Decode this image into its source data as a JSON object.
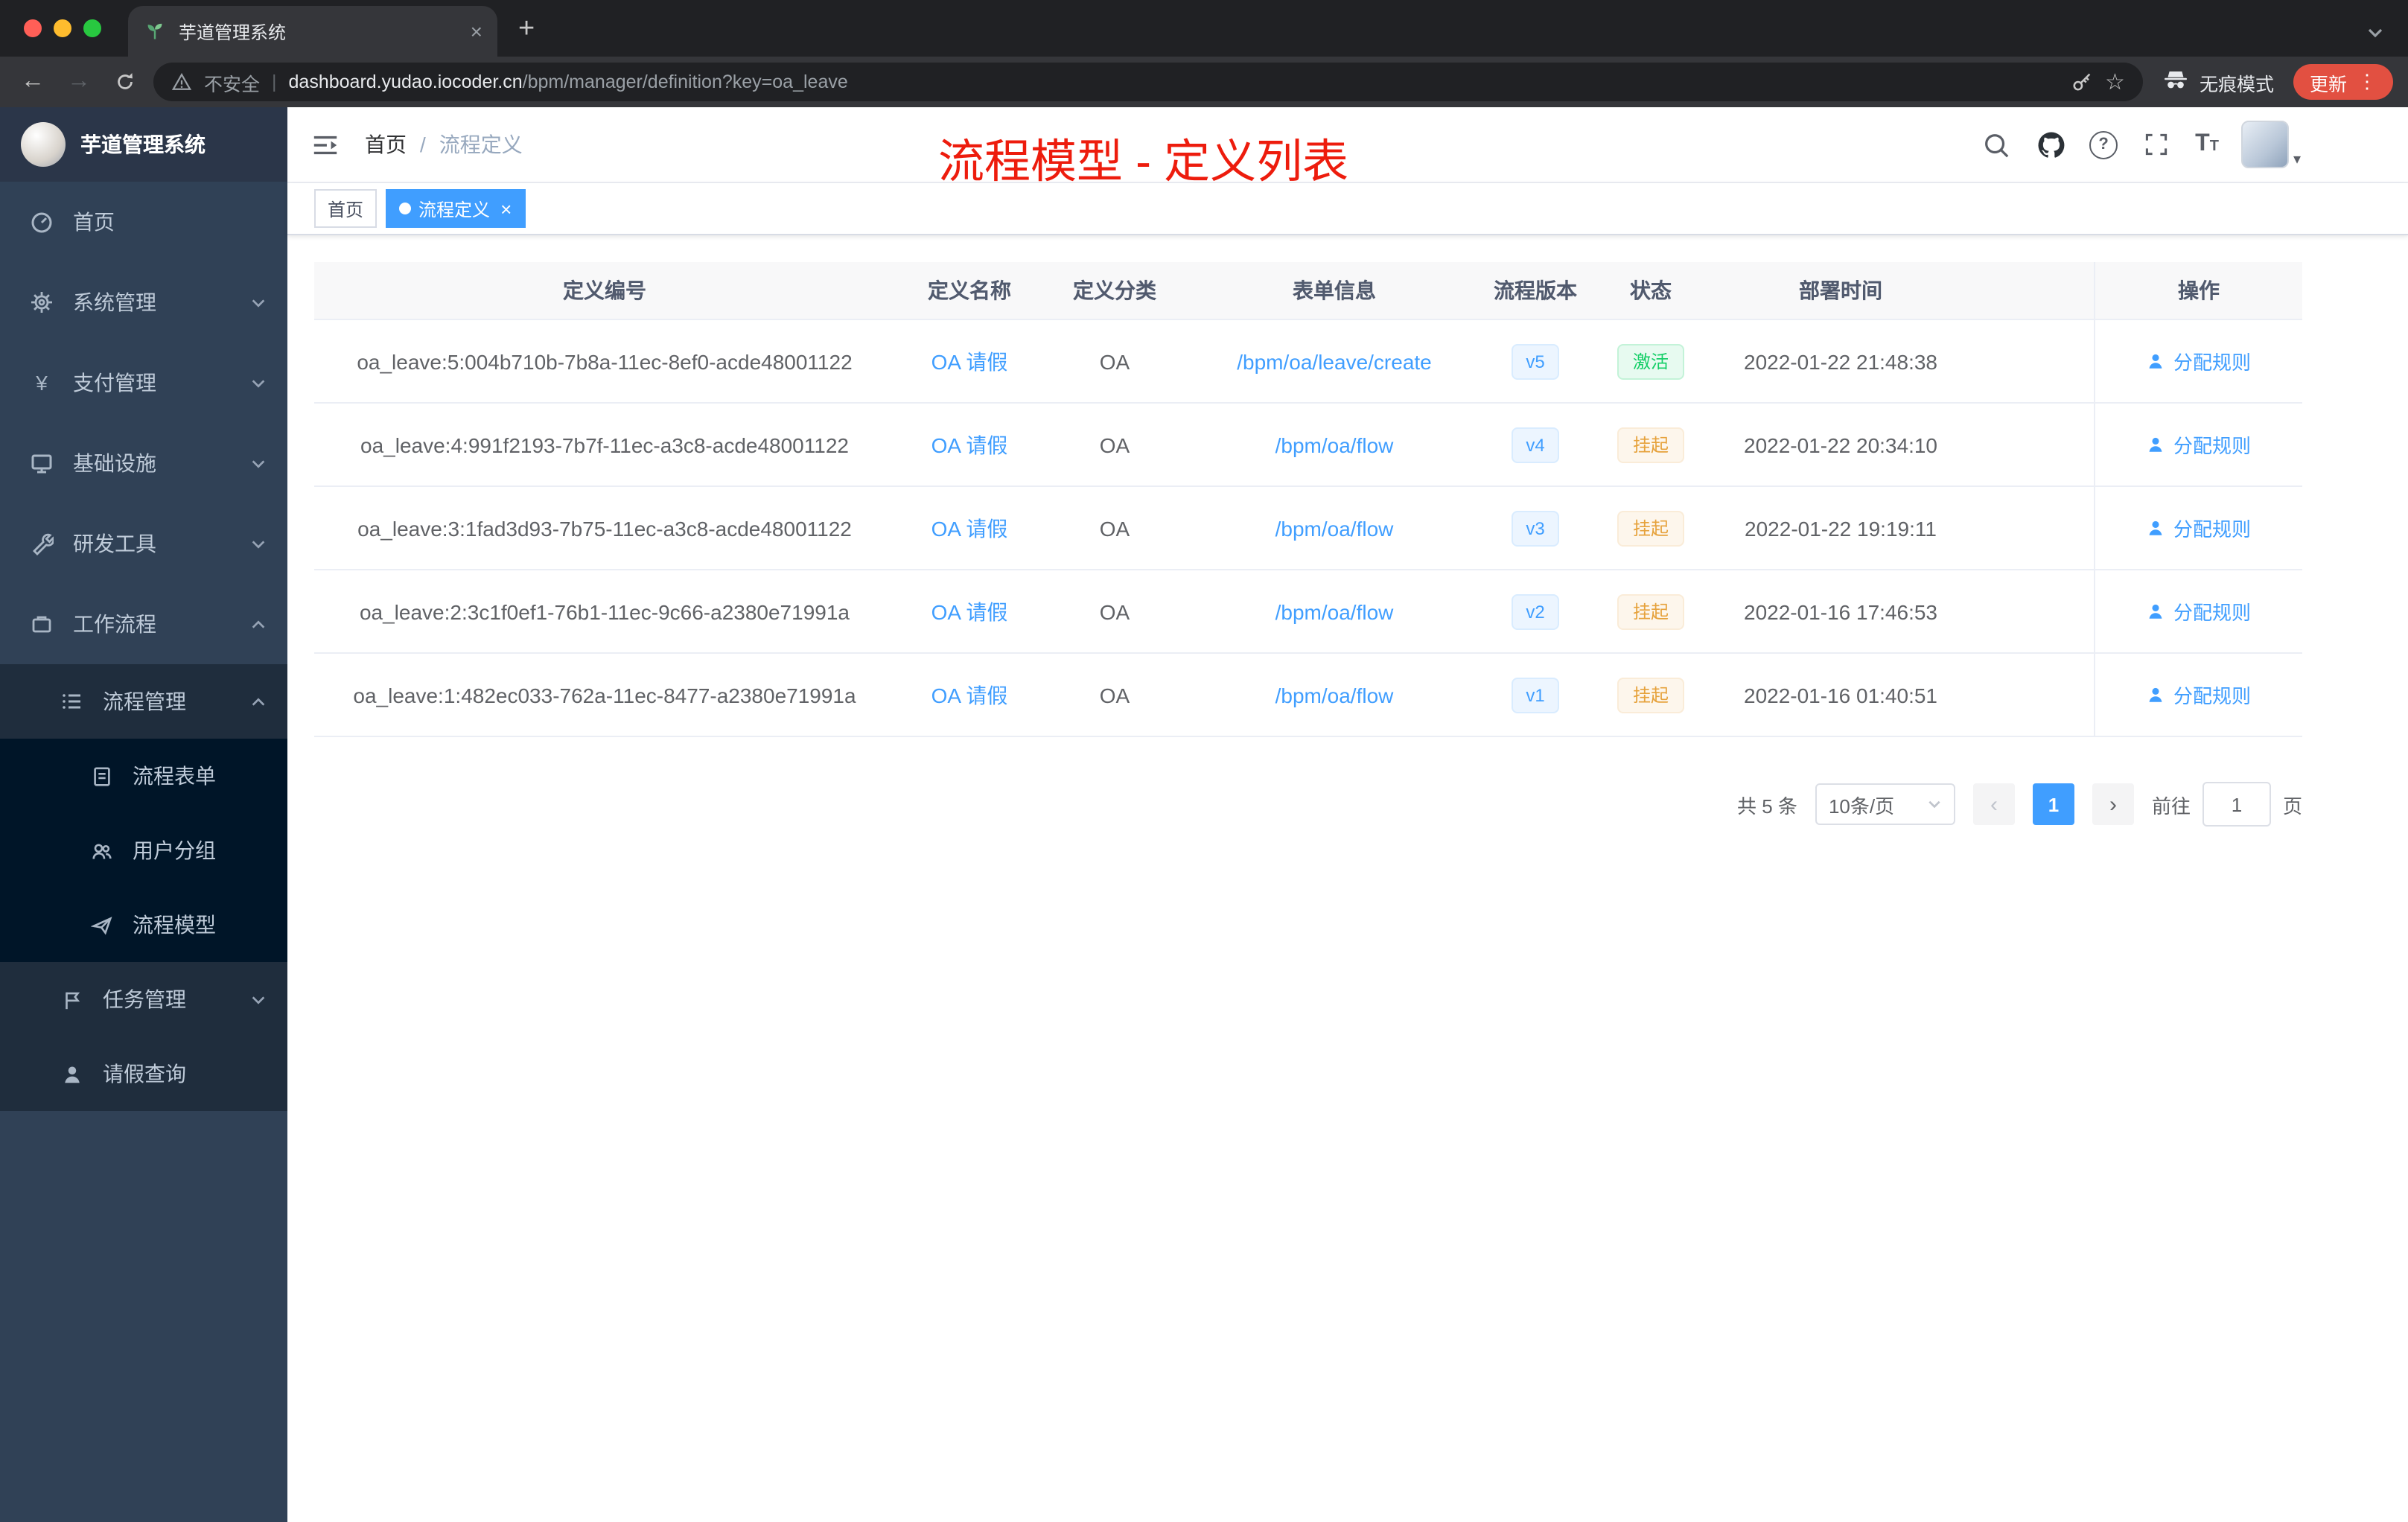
{
  "colors": {
    "accent": "#409eff",
    "success": "#13ce66",
    "warning": "#e6a23c",
    "annotation_red": "#ed1c0d",
    "sidebar_bg": "#304156",
    "submenu_bg": "#1f2d3d"
  },
  "icons": {
    "back": "←",
    "forward": "→",
    "star": "☆",
    "close": "×",
    "plus": "+",
    "dots": "⋮",
    "question": "?",
    "caret_down": "▾",
    "prev": "‹",
    "next": "›",
    "yen": "¥",
    "text_large": "T",
    "text_small": "T"
  },
  "browser": {
    "tab_title": "芋道管理系统",
    "security_label": "不安全",
    "url_host": "dashboard.yudao.iocoder.cn",
    "url_path": "/bpm/manager/definition?key=oa_leave",
    "incognito_label": "无痕模式",
    "update_label": "更新"
  },
  "sidebar": {
    "logo_title": "芋道管理系统",
    "items": {
      "home": "首页",
      "system": "系统管理",
      "payment": "支付管理",
      "infra": "基础设施",
      "devtools": "研发工具",
      "workflow": "工作流程",
      "process_mgmt": "流程管理",
      "process_form": "流程表单",
      "user_group": "用户分组",
      "process_model": "流程模型",
      "task_mgmt": "任务管理",
      "leave_query": "请假查询"
    }
  },
  "header": {
    "breadcrumb_home": "首页",
    "breadcrumb_separator": "/",
    "breadcrumb_current": "流程定义",
    "annotation": "流程模型 - 定义列表"
  },
  "tags": {
    "home": "首页",
    "active": "流程定义"
  },
  "table": {
    "columns": [
      "定义编号",
      "定义名称",
      "定义分类",
      "表单信息",
      "流程版本",
      "状态",
      "部署时间",
      "操作"
    ],
    "rows": [
      {
        "id": "oa_leave:5:004b710b-7b8a-11ec-8ef0-acde48001122",
        "name": "OA 请假",
        "category": "OA",
        "form": "/bpm/oa/leave/create",
        "version": "v5",
        "status": "激活",
        "deployed": "2022-01-22 21:48:38",
        "action": "分配规则"
      },
      {
        "id": "oa_leave:4:991f2193-7b7f-11ec-a3c8-acde48001122",
        "name": "OA 请假",
        "category": "OA",
        "form": "/bpm/oa/flow",
        "version": "v4",
        "status": "挂起",
        "deployed": "2022-01-22 20:34:10",
        "action": "分配规则"
      },
      {
        "id": "oa_leave:3:1fad3d93-7b75-11ec-a3c8-acde48001122",
        "name": "OA 请假",
        "category": "OA",
        "form": "/bpm/oa/flow",
        "version": "v3",
        "status": "挂起",
        "deployed": "2022-01-22 19:19:11",
        "action": "分配规则"
      },
      {
        "id": "oa_leave:2:3c1f0ef1-76b1-11ec-9c66-a2380e71991a",
        "name": "OA 请假",
        "category": "OA",
        "form": "/bpm/oa/flow",
        "version": "v2",
        "status": "挂起",
        "deployed": "2022-01-16 17:46:53",
        "action": "分配规则"
      },
      {
        "id": "oa_leave:1:482ec033-762a-11ec-8477-a2380e71991a",
        "name": "OA 请假",
        "category": "OA",
        "form": "/bpm/oa/flow",
        "version": "v1",
        "status": "挂起",
        "deployed": "2022-01-16 01:40:51",
        "action": "分配规则"
      }
    ]
  },
  "pagination": {
    "total_label": "共 5 条",
    "page_size_label": "10条/页",
    "current_page": "1",
    "goto_prefix": "前往",
    "goto_value": "1",
    "goto_suffix": "页"
  }
}
